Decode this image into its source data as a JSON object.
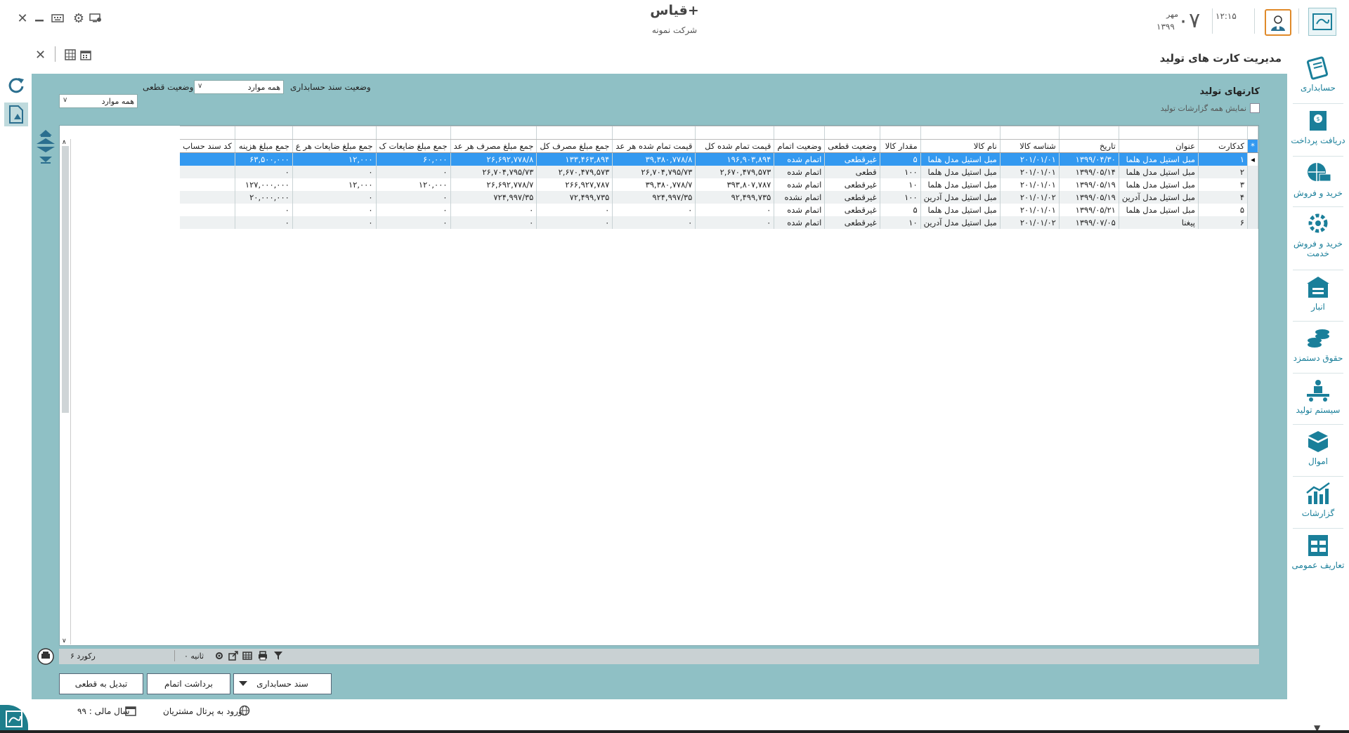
{
  "window": {
    "app_title": "قیاس+",
    "company": "شرکت نمونه",
    "time": "۱۲:۱۵",
    "day": "۰۷",
    "month": "مهر",
    "year": "۱۳۹۹"
  },
  "page": {
    "title": "مدیریت کارت های تولید"
  },
  "filters": {
    "accounting_status_label": "وضعیت سند حسابداری",
    "accounting_status_value": "همه موارد",
    "final_status_label": "وضعیت قطعی",
    "final_status_value": "همه موارد"
  },
  "section": {
    "title": "کارتهای تولید",
    "show_all_label": "نمایش همه گزارشات تولید"
  },
  "sidebar": {
    "items": [
      {
        "label": "حسابداری",
        "icon": "accounting-icon"
      },
      {
        "label": "دریافت پرداخت",
        "icon": "payment-icon"
      },
      {
        "label": "خرید و فروش",
        "icon": "trade-icon"
      },
      {
        "label": "خرید و فروش خدمت",
        "icon": "service-icon"
      },
      {
        "label": "انبار",
        "icon": "warehouse-icon"
      },
      {
        "label": "حقوق دستمزد",
        "icon": "salary-icon"
      },
      {
        "label": "سیستم تولید",
        "icon": "production-icon"
      },
      {
        "label": "اموال",
        "icon": "assets-icon"
      },
      {
        "label": "گزارشات",
        "icon": "reports-icon"
      },
      {
        "label": "تعاریف عمومی",
        "icon": "definitions-icon"
      }
    ]
  },
  "table": {
    "columns": [
      "کدکارت",
      "عنوان",
      "تاریخ",
      "شناسه کالا",
      "نام کالا",
      "مقدار کالا",
      "وضعیت قطعی",
      "وضعیت اتمام",
      "قیمت تمام شده کل",
      "قیمت تمام شده هر عد",
      "جمع مبلغ مصرف کل",
      "جمع مبلغ مصرف هر عد",
      "جمع مبلغ ضایعات ک",
      "جمع مبلغ ضایعات هر ع",
      "جمع مبلغ هزینه",
      "کد سند حساب"
    ],
    "rows": [
      [
        "۱",
        "مبل استیل مدل هلما",
        "۱۳۹۹/۰۴/۳۰",
        "۲۰۱/۰۱/۰۱",
        "مبل استیل مدل هلما",
        "۵",
        "غیرقطعی",
        "اتمام شده",
        "۱۹۶,۹۰۳,۸۹۴",
        "۳۹,۳۸۰,۷۷۸/۸",
        "۱۳۳,۴۶۳,۸۹۴",
        "۲۶,۶۹۲,۷۷۸/۸",
        "۶۰,۰۰۰",
        "۱۲,۰۰۰",
        "۶۳,۵۰۰,۰۰۰",
        ""
      ],
      [
        "۲",
        "مبل استیل مدل هلما",
        "۱۳۹۹/۰۵/۱۴",
        "۲۰۱/۰۱/۰۱",
        "مبل استیل مدل هلما",
        "۱۰۰",
        "قطعی",
        "اتمام شده",
        "۲,۶۷۰,۴۷۹,۵۷۳",
        "۲۶,۷۰۴,۷۹۵/۷۳",
        "۲,۶۷۰,۴۷۹,۵۷۳",
        "۲۶,۷۰۴,۷۹۵/۷۳",
        "۰",
        "۰",
        "۰",
        ""
      ],
      [
        "۳",
        "مبل استیل مدل هلما",
        "۱۳۹۹/۰۵/۱۹",
        "۲۰۱/۰۱/۰۱",
        "مبل استیل مدل هلما",
        "۱۰",
        "غیرقطعی",
        "اتمام شده",
        "۳۹۳,۸۰۷,۷۸۷",
        "۳۹,۳۸۰,۷۷۸/۷",
        "۲۶۶,۹۲۷,۷۸۷",
        "۲۶,۶۹۲,۷۷۸/۷",
        "۱۲۰,۰۰۰",
        "۱۲,۰۰۰",
        "۱۲۷,۰۰۰,۰۰۰",
        ""
      ],
      [
        "۴",
        "مبل استیل مدل آدرین",
        "۱۳۹۹/۰۵/۱۹",
        "۲۰۱/۰۱/۰۲",
        "مبل استیل مدل آدرین",
        "۱۰۰",
        "غیرقطعی",
        "اتمام نشده",
        "۹۲,۴۹۹,۷۳۵",
        "۹۲۴,۹۹۷/۳۵",
        "۷۲,۴۹۹,۷۳۵",
        "۷۲۴,۹۹۷/۳۵",
        "۰",
        "۰",
        "۲۰,۰۰۰,۰۰۰",
        ""
      ],
      [
        "۵",
        "مبل استیل مدل هلما",
        "۱۳۹۹/۰۵/۲۱",
        "۲۰۱/۰۱/۰۱",
        "مبل استیل مدل هلما",
        "۵",
        "غیرقطعی",
        "اتمام شده",
        "۰",
        "۰",
        "۰",
        "۰",
        "۰",
        "۰",
        "۰",
        ""
      ],
      [
        "۶",
        "پیغنا",
        "۱۳۹۹/۰۷/۰۵",
        "۲۰۱/۰۱/۰۲",
        "مبل استیل مدل آدرین",
        "۱۰",
        "غیرقطعی",
        "اتمام شده",
        "۰",
        "۰",
        "۰",
        "۰",
        "۰",
        "۰",
        "۰",
        ""
      ]
    ]
  },
  "footer": {
    "record_count": "۶ رکورد",
    "seconds": "۰ ثانیه"
  },
  "actions": {
    "accounting_doc": "سند حسابداری",
    "completion_withdraw": "برداشت اتمام",
    "convert_final": "تبدیل به قطعی"
  },
  "status": {
    "fiscal_year": "سال مالی : ۹۹",
    "portal_login": "ورود به پرتال مشتریان"
  },
  "colors": {
    "accent": "#1a7f9a",
    "panel": "#8fc0c5",
    "selected_row": "#3399f0"
  }
}
